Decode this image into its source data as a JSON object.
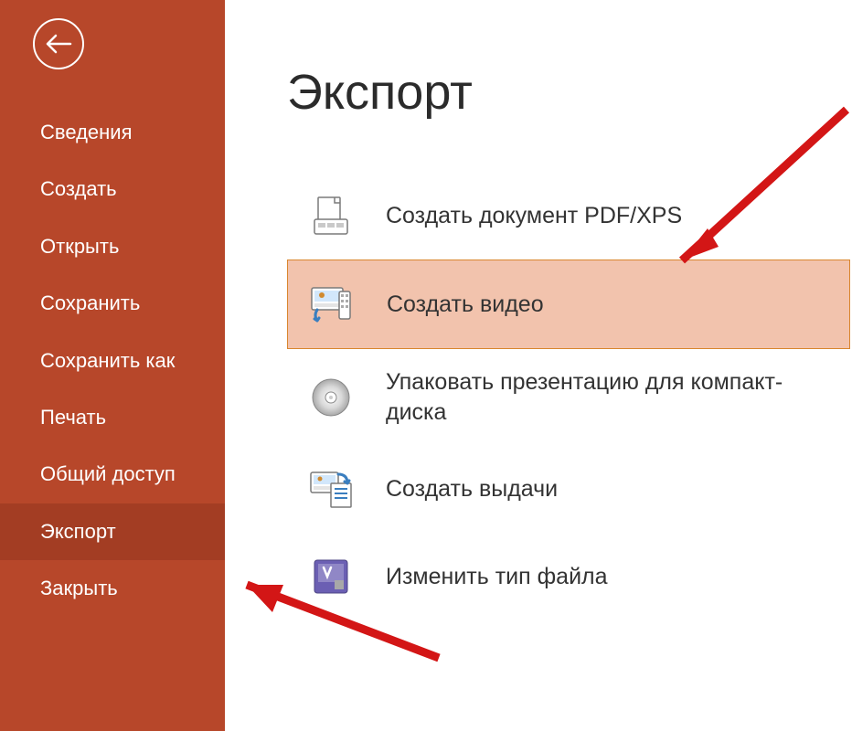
{
  "sidebar": {
    "items": [
      {
        "label": "Сведения"
      },
      {
        "label": "Создать"
      },
      {
        "label": "Открыть"
      },
      {
        "label": "Сохранить"
      },
      {
        "label": "Сохранить как"
      },
      {
        "label": "Печать"
      },
      {
        "label": "Общий доступ"
      },
      {
        "label": "Экспорт"
      },
      {
        "label": "Закрыть"
      }
    ],
    "active_index": 7
  },
  "main": {
    "title": "Экспорт",
    "options": [
      {
        "label": "Создать документ PDF/XPS",
        "icon": "pdf-xps-icon"
      },
      {
        "label": "Создать видео",
        "icon": "create-video-icon"
      },
      {
        "label": "Упаковать презентацию для компакт-диска",
        "icon": "package-cd-icon"
      },
      {
        "label": "Создать выдачи",
        "icon": "create-handouts-icon"
      },
      {
        "label": "Изменить тип файла",
        "icon": "change-file-type-icon"
      }
    ],
    "selected_index": 1
  },
  "colors": {
    "accent": "#b7472a",
    "selection_bg": "#f2c3ad",
    "selection_border": "#d9862e",
    "arrow": "#d31616"
  }
}
